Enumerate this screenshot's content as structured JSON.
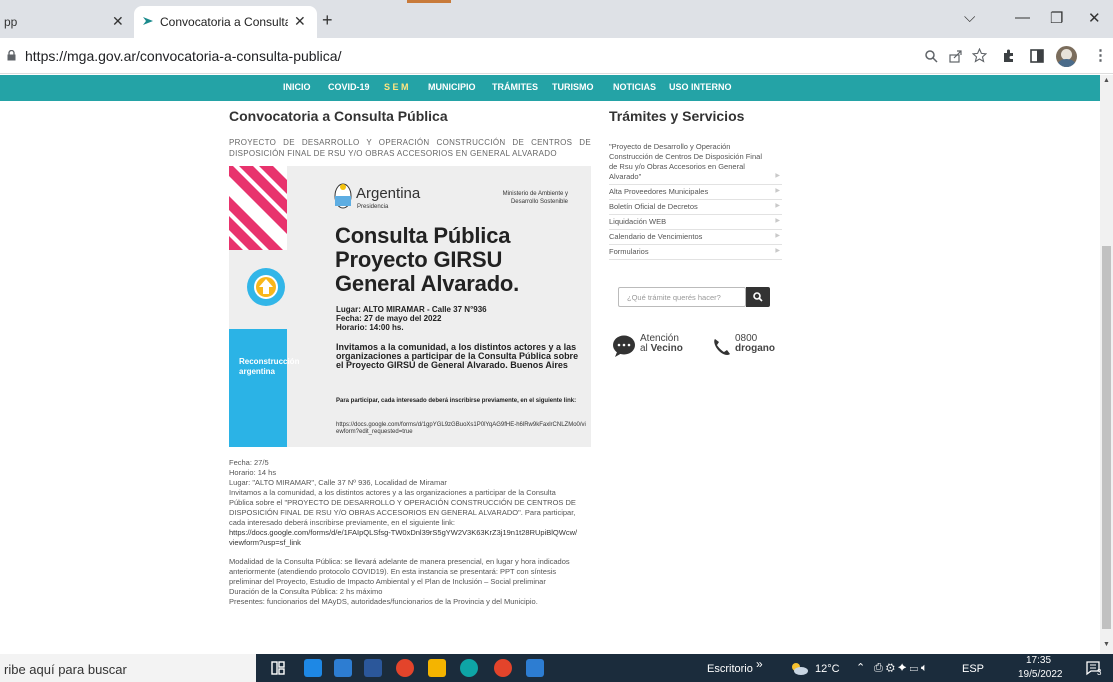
{
  "browser": {
    "prev_tab_title": "pp",
    "active_tab_title": "Convocatoria a Consulta Pública",
    "new_tab": "+",
    "close": "✕",
    "url": "https://mga.gov.ar/convocatoria-a-consulta-publica/",
    "window": {
      "minimize": "—",
      "maximize": "❐",
      "close": "✕",
      "tab_search": "⌵"
    }
  },
  "nav": {
    "items": [
      "INICIO",
      "COVID-19",
      "S E M",
      "MUNICIPIO",
      "TRÁMITES",
      "TURISMO",
      "NOTICIAS",
      "USO INTERNO"
    ]
  },
  "main": {
    "title": "Convocatoria a Consulta Pública",
    "subtitle": "PROYECTO DE DESARROLLO Y OPERACIÓN CONSTRUCCIÓN DE CENTROS DE DISPOSICIÓN FINAL DE RSU Y/O OBRAS ACCESORIOS EN GENERAL ALVARADO",
    "poster": {
      "argentina": "Argentina",
      "presidencia": "Presidencia",
      "ministry": "Ministerio de Ambiente y Desarrollo Sostenible",
      "title_lines": [
        "Consulta Pública",
        "Proyecto GIRSU",
        "General Alvarado."
      ],
      "info": [
        "Lugar: ALTO MIRAMAR - Calle 37 N°936",
        "Fecha: 27 de mayo del 2022",
        "Horario: 14:00 hs."
      ],
      "invite": "Invitamos a la comunidad, a los distintos actores y a las organizaciones a participar de la Consulta Pública sobre el Proyecto GIRSU de General Alvarado. Buenos Aires",
      "participate": "Para participar, cada interesado deberá inscribirse previamente, en el siguiente link:",
      "link": "https://docs.google.com/forms/d/1gpYGL9zGBuoXs1P0lYqAG9fHE-h6lRw9kFaxlrCNLZMo0/viewform?edit_requested=true",
      "side_label": "Reconstrucción argentina"
    },
    "paragraph1": [
      "Fecha: 27/5",
      "Horario: 14 hs",
      "Lugar: \"ALTO MIRAMAR\", Calle 37 Nº 936, Localidad de Miramar",
      "Invitamos a la comunidad, a los distintos actores y a las organizaciones a participar de la Consulta Pública sobre el \"PROYECTO DE DESARROLLO Y OPERACIÓN CONSTRUCCIÓN DE CENTROS DE DISPOSICIÓN FINAL DE RSU Y/O OBRAS ACCESORIOS EN GENERAL ALVARADO\". Para participar, cada interesado deberá inscribirse previamente, en el siguiente link:",
      "https://docs.google.com/forms/d/e/1FAIpQLSfsg-TW0xDnl39rS5gYW2V3K63KrZ3j19n1t28RUpiBlQWcw/viewform?usp=sf_link"
    ],
    "paragraph2": [
      "Modalidad de la Consulta Pública: se llevará adelante de manera presencial, en lugar y hora indicados anteriormente (atendiendo protocolo COVID19). En esta instancia se presentará: PPT con síntesis preliminar del Proyecto, Estudio de Impacto Ambiental y el Plan de Inclusión – Social preliminar",
      "Duración de la Consulta Pública: 2 hs máximo",
      "Presentes: funcionarios del MAyDS, autoridades/funcionarios de la Provincia y del Municipio."
    ]
  },
  "sidebar": {
    "title": "Trámites y Servicios",
    "items": [
      "\"Proyecto de Desarrollo y Operación Construcción de Centros De Disposición Final de Rsu y/o Obras Accesorios en General Alvarado\"",
      "Alta Proveedores Municipales",
      "Boletín Oficial de Decretos",
      "Liquidación WEB",
      "Calendario de Vencimientos",
      "Formularios"
    ],
    "search_placeholder": "¿Qué trámite querés hacer?",
    "atencion_line1": "Atención",
    "atencion_line2_a": "al ",
    "atencion_line2_b": "Vecino",
    "phone_line1": "0800",
    "phone_line2": "drogano"
  },
  "taskbar": {
    "search": "ribe aquí para buscar",
    "escritorio": "Escritorio",
    "chevron": "»",
    "temp": "12°C",
    "lang": "ESP",
    "time": "17:35",
    "date": "19/5/2022",
    "notif_count": "3"
  }
}
